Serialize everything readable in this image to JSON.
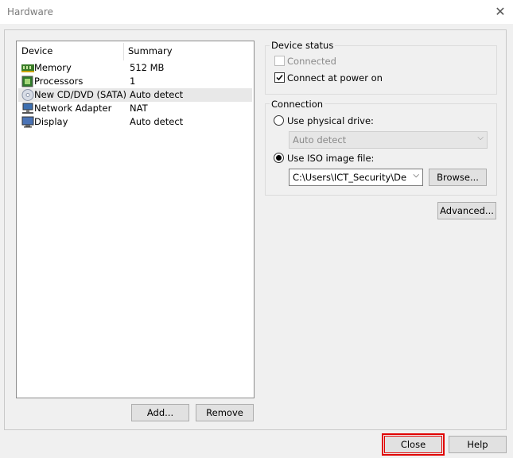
{
  "window": {
    "title": "Hardware"
  },
  "device_list": {
    "columns": [
      "Device",
      "Summary"
    ],
    "rows": [
      {
        "device": "Memory",
        "summary": "512 MB",
        "icon": "memory-icon"
      },
      {
        "device": "Processors",
        "summary": "1",
        "icon": "processor-icon"
      },
      {
        "device": "New CD/DVD (SATA)",
        "summary": "Auto detect",
        "icon": "cd-dvd-icon",
        "selected": true
      },
      {
        "device": "Network Adapter",
        "summary": "NAT",
        "icon": "network-adapter-icon"
      },
      {
        "device": "Display",
        "summary": "Auto detect",
        "icon": "display-icon"
      }
    ]
  },
  "buttons": {
    "add": "Add...",
    "remove": "Remove",
    "browse": "Browse...",
    "advanced": "Advanced...",
    "close": "Close",
    "help": "Help"
  },
  "device_status": {
    "title": "Device status",
    "connected": "Connected",
    "connect_at_power_on": "Connect at power on"
  },
  "connection": {
    "title": "Connection",
    "use_physical_drive": "Use physical drive:",
    "physical_drive_value": "Auto detect",
    "use_iso": "Use ISO image file:",
    "iso_path": "C:\\Users\\ICT_Security\\De"
  },
  "colors": {
    "highlight": "#e00000"
  }
}
